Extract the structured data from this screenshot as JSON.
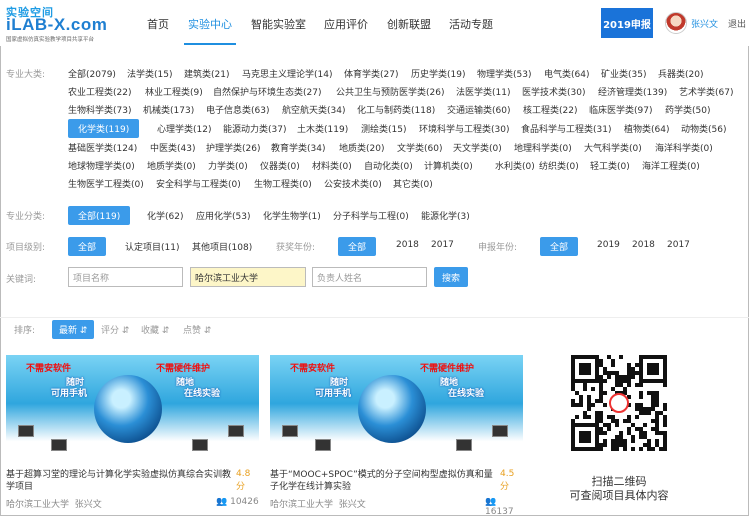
{
  "header": {
    "logo_top": "实验空间",
    "logo_main": "iLAB-X.com",
    "logo_sub": "国家虚拟仿真实验教学项目共享平台",
    "nav": [
      "首页",
      "实验中心",
      "智能实验室",
      "应用评价",
      "创新联盟",
      "活动专题"
    ],
    "active_nav": "实验中心",
    "badge": "2019申报",
    "user_name": "张兴文",
    "logout": "退出"
  },
  "filters": {
    "major_label": "专业大类:",
    "major_items": [
      [
        "全部(2079)",
        "法学类(15)",
        "建筑类(21)",
        "马克思主义理论学(14)",
        "体育学类(27)",
        "历史学类(19)",
        "物理学类(53)",
        "电气类(64)",
        "矿业类(35)",
        "兵器类(20)"
      ],
      [
        "农业工程类(22)",
        "林业工程类(9)",
        "自然保护与环境生态类(27)",
        "公共卫生与预防医学类(26)",
        "法医学类(11)",
        "医学技术类(30)",
        "经济管理类(139)",
        "艺术学类(67)"
      ],
      [
        "生物科学类(73)",
        "机械类(173)",
        "电子信息类(63)",
        "航空航天类(34)",
        "化工与制药类(118)",
        "交通运输类(60)",
        "核工程类(22)",
        "临床医学类(97)",
        "药学类(50)"
      ],
      [
        "化学类(119)",
        "心理学类(12)",
        "能源动力类(37)",
        "土木类(119)",
        "测绘类(15)",
        "环境科学与工程类(30)",
        "食品科学与工程类(31)",
        "植物类(64)",
        "动物类(56)"
      ],
      [
        "基础医学类(124)",
        "中医类(43)",
        "护理学类(26)",
        "教育学类(34)",
        "地质类(20)",
        "文学类(60)",
        "天文学类(0)",
        "地理科学类(0)",
        "大气科学类(0)",
        "海洋科学类(0)"
      ],
      [
        "地球物理学类(0)",
        "地质学类(0)",
        "力学类(0)",
        "仪器类(0)",
        "材料类(0)",
        "自动化类(0)",
        "计算机类(0)",
        "水利类(0)",
        "纺织类(0)",
        "轻工类(0)",
        "海洋工程类(0)"
      ],
      [
        "生物医学工程类(0)",
        "安全科学与工程类(0)",
        "生物工程类(0)",
        "公安技术类(0)",
        "其它类(0)"
      ]
    ],
    "major_selected": "化学类(119)",
    "sub_label": "专业分类:",
    "sub_items": [
      "全部(119)",
      "化学(62)",
      "应用化学(53)",
      "化学生物学(1)",
      "分子科学与工程(0)",
      "能源化学(3)"
    ],
    "level_label": "项目级别:",
    "level_items": [
      "全部",
      "认定项目(11)",
      "其他项目(108)"
    ],
    "award_label": "获奖年份:",
    "award_items": [
      "全部",
      "2018",
      "2017"
    ],
    "apply_label": "申报年份:",
    "apply_items": [
      "全部",
      "2019",
      "2018",
      "2017"
    ],
    "keyword_label": "关键词:",
    "project_name_placeholder": "项目名称",
    "school_value": "哈尔滨工业大学",
    "leader_placeholder": "负责人姓名",
    "search_label": "搜索"
  },
  "sort": {
    "label": "排序:",
    "selected": "最新",
    "items": [
      "评分",
      "收藏",
      "点赞"
    ]
  },
  "cards": [
    {
      "banner": [
        "不需安软件",
        "不需硬件维护",
        "随时",
        "随地",
        "可用手机",
        "在线实验"
      ],
      "title": "基于超算习堂的理论与计算化学实验虚拟仿真综合实训教学项目",
      "score": "4.8 分",
      "school": "哈尔滨工业大学",
      "author": "张兴文",
      "views": "10426"
    },
    {
      "banner": [
        "不需安软件",
        "不需硬件维护",
        "随时",
        "随地",
        "可用手机",
        "在线实验"
      ],
      "title": "基于“MOOC+SPOC”模式的分子空间构型虚拟仿真和量子化学在线计算实验",
      "score": "4.5 分",
      "school": "哈尔滨工业大学",
      "author": "张兴文",
      "views": "16137"
    }
  ],
  "qr": {
    "line1": "扫描二维码",
    "line2": "可查阅项目具体内容"
  }
}
